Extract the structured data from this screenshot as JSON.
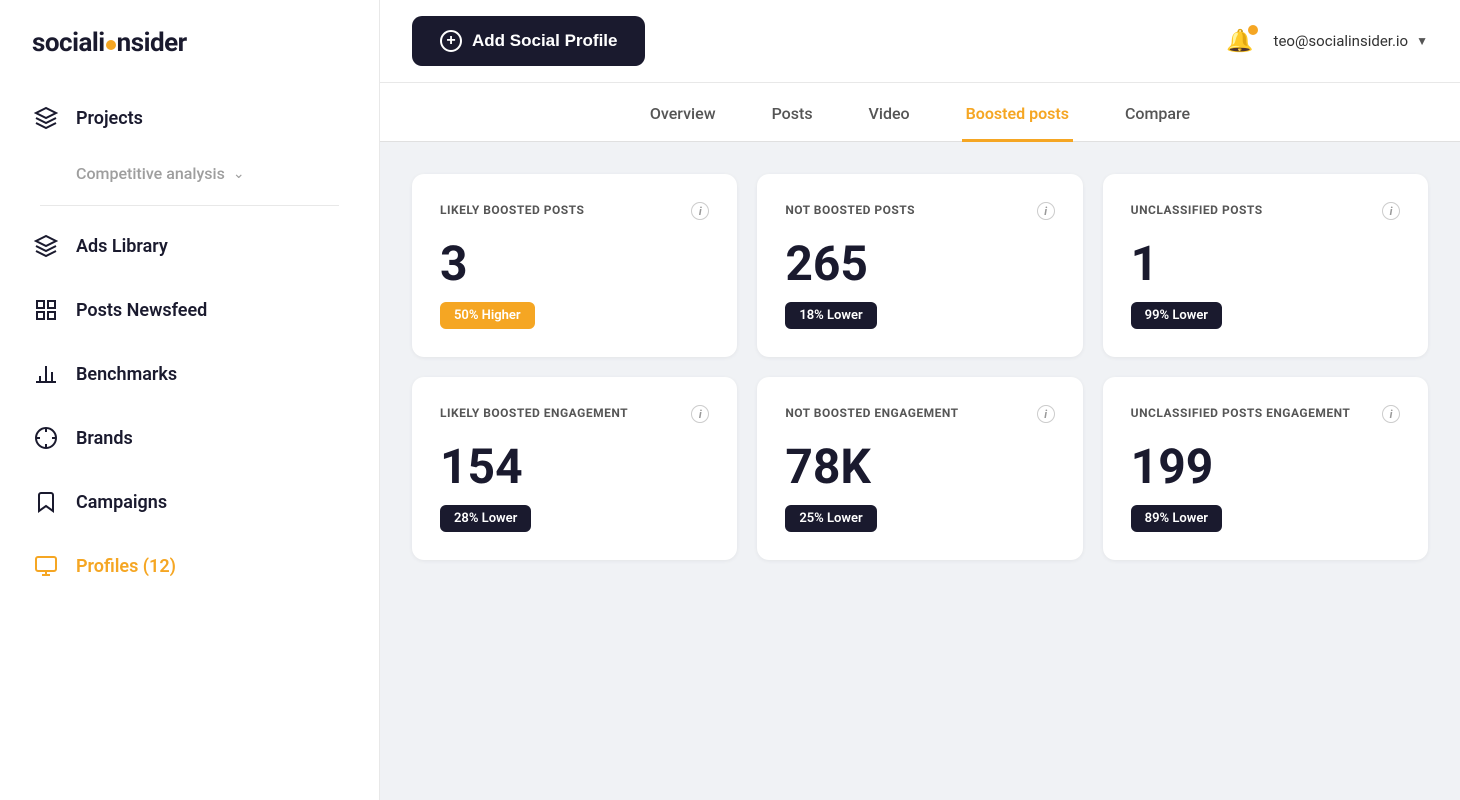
{
  "sidebar": {
    "logo": "socialinsider",
    "nav_items": [
      {
        "id": "projects",
        "label": "Projects",
        "icon": "layers"
      },
      {
        "id": "competitive",
        "label": "Competitive analysis",
        "icon": ""
      },
      {
        "id": "ads-library",
        "label": "Ads Library",
        "icon": "layers"
      },
      {
        "id": "posts-newsfeed",
        "label": "Posts Newsfeed",
        "icon": "grid"
      },
      {
        "id": "benchmarks",
        "label": "Benchmarks",
        "icon": "bar-chart"
      },
      {
        "id": "brands",
        "label": "Brands",
        "icon": "crosshair"
      },
      {
        "id": "campaigns",
        "label": "Campaigns",
        "icon": "bookmark"
      },
      {
        "id": "profiles",
        "label": "Profiles (12)",
        "icon": "profile",
        "active": true
      }
    ]
  },
  "header": {
    "add_profile_label": "Add Social Profile",
    "user_email": "teo@socialinsider.io"
  },
  "tabs": [
    {
      "id": "overview",
      "label": "Overview"
    },
    {
      "id": "posts",
      "label": "Posts"
    },
    {
      "id": "video",
      "label": "Video"
    },
    {
      "id": "boosted",
      "label": "Boosted posts",
      "active": true
    },
    {
      "id": "compare",
      "label": "Compare"
    }
  ],
  "stats": [
    {
      "title": "LIKELY BOOSTED POSTS",
      "value": "3",
      "badge_label": "50% Higher",
      "badge_type": "orange"
    },
    {
      "title": "NOT BOOSTED POSTS",
      "value": "265",
      "badge_label": "18% Lower",
      "badge_type": "dark"
    },
    {
      "title": "UNCLASSIFIED POSTS",
      "value": "1",
      "badge_label": "99% Lower",
      "badge_type": "dark"
    },
    {
      "title": "LIKELY BOOSTED ENGAGEMENT",
      "value": "154",
      "badge_label": "28% Lower",
      "badge_type": "dark"
    },
    {
      "title": "NOT BOOSTED ENGAGEMENT",
      "value": "78K",
      "badge_label": "25% Lower",
      "badge_type": "dark"
    },
    {
      "title": "UNCLASSIFIED POSTS ENGAGEMENT",
      "value": "199",
      "badge_label": "89% Lower",
      "badge_type": "dark"
    }
  ]
}
